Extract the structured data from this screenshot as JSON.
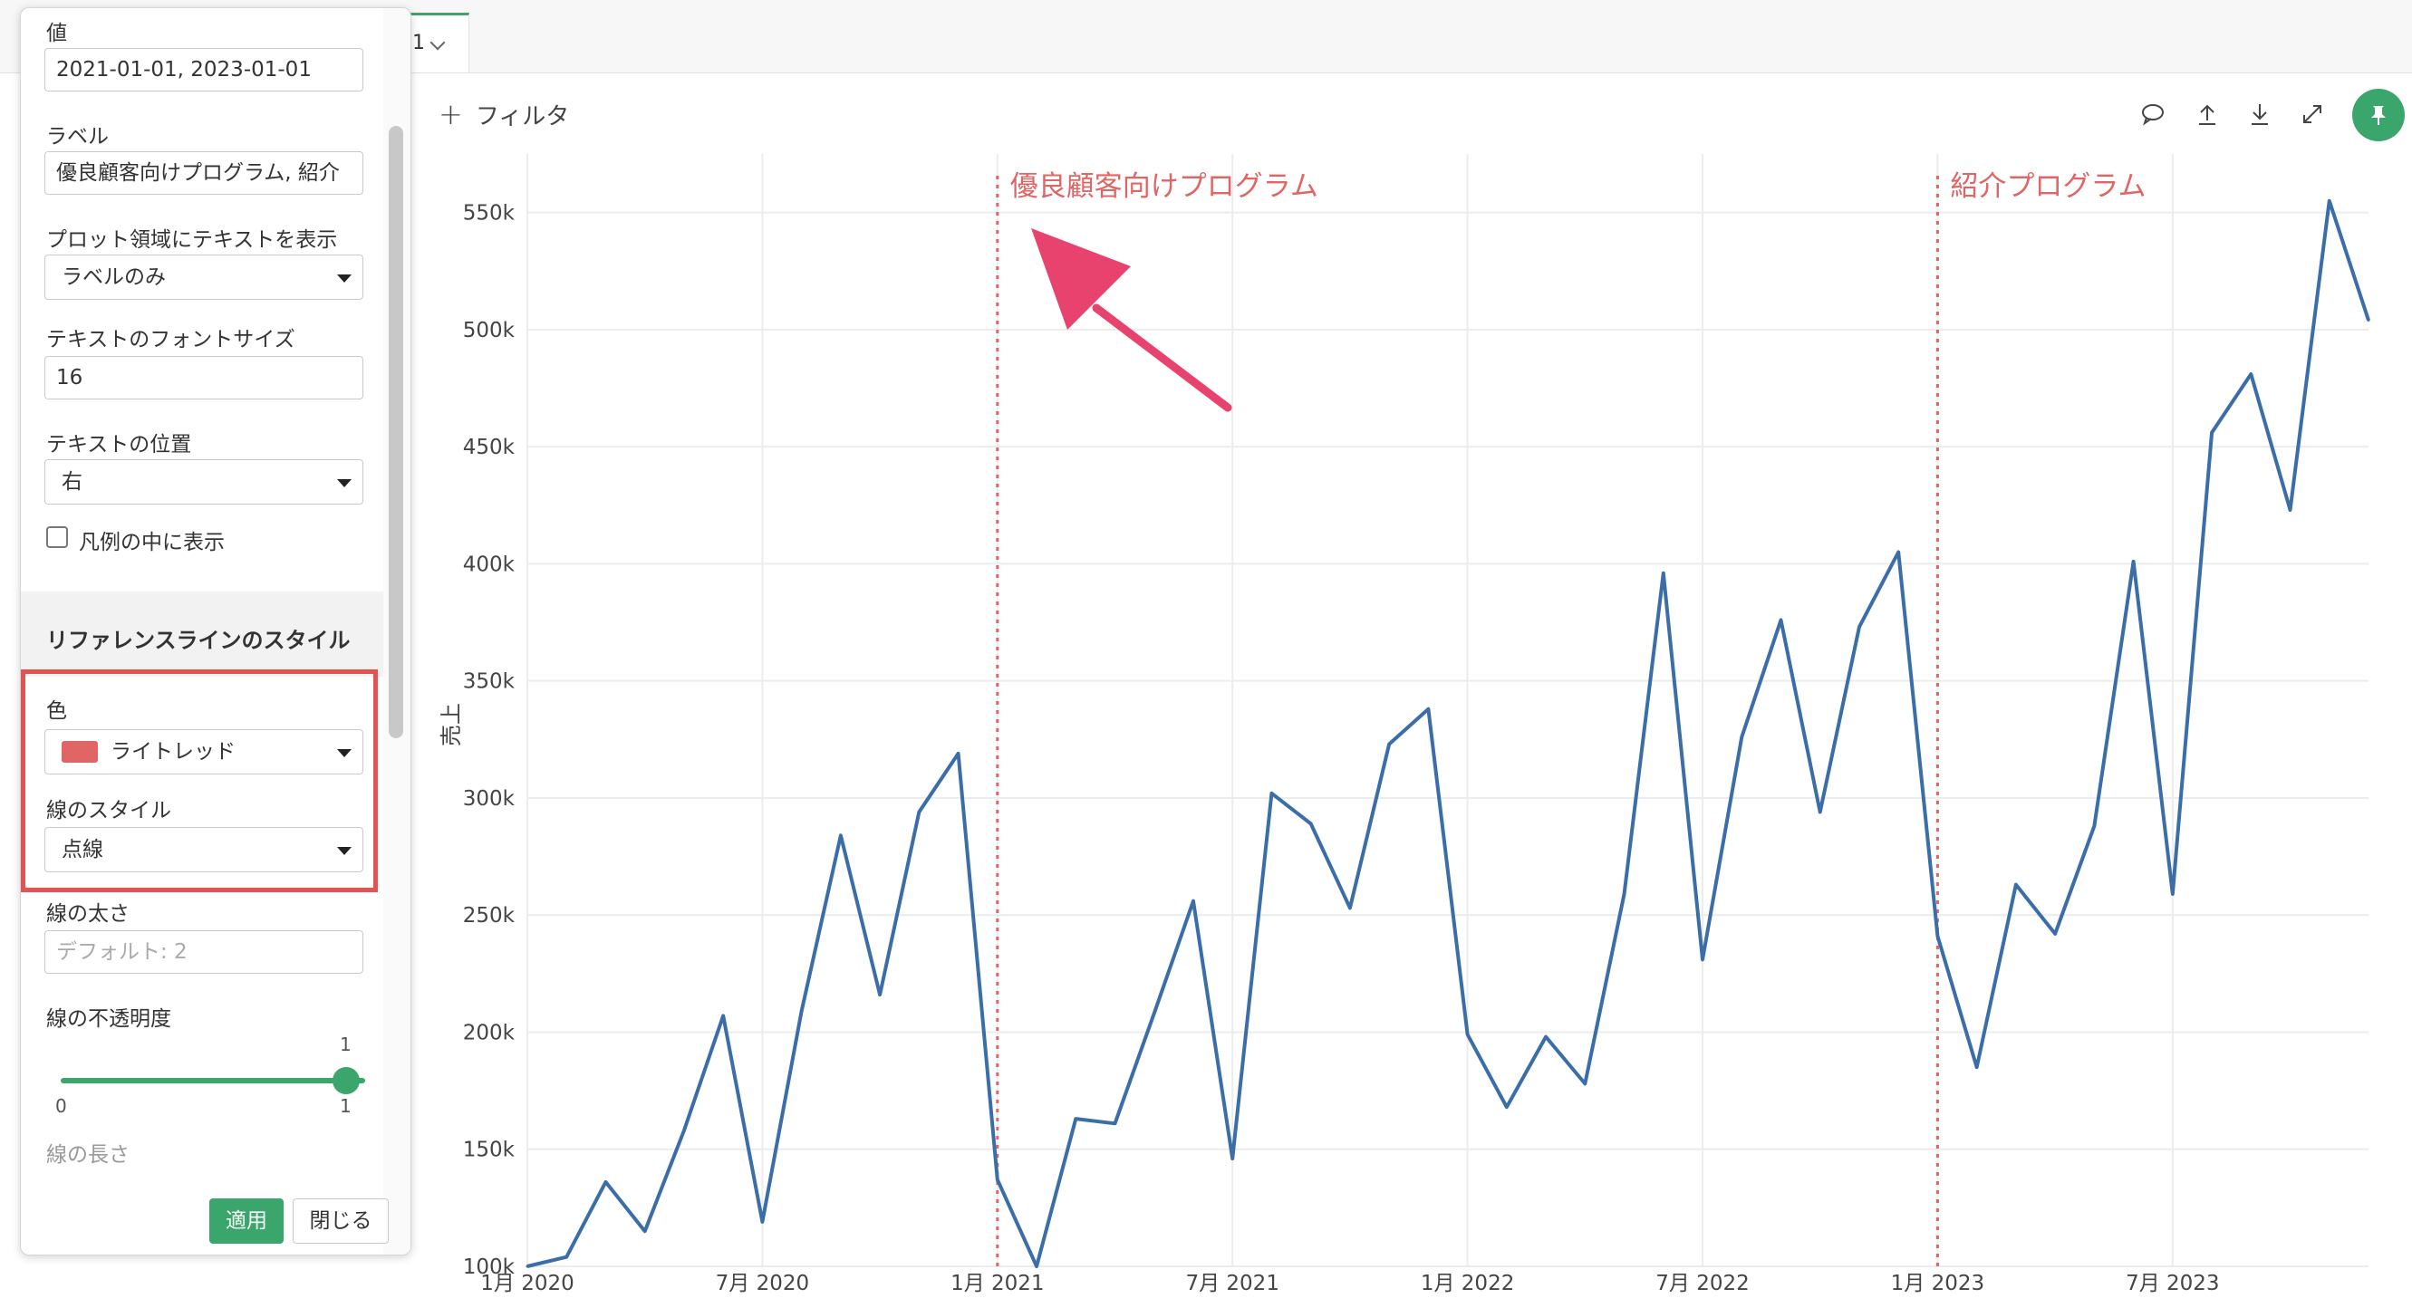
{
  "tab": {
    "label": "1"
  },
  "toolbar": {
    "filter_label": "フィルタ",
    "icons": [
      "comment-icon",
      "upload-icon",
      "download-icon",
      "expand-icon",
      "pin-icon"
    ],
    "accent": "#3aa66b"
  },
  "panel": {
    "value_label": "値",
    "value": "2021-01-01, 2023-01-01",
    "label_label": "ラベル",
    "label_value": "優良顧客向けプログラム, 紹介",
    "show_text_label": "プロット領域にテキストを表示",
    "show_text_value": "ラベルのみ",
    "font_size_label": "テキストのフォントサイズ",
    "font_size_value": "16",
    "text_position_label": "テキストの位置",
    "text_position_value": "右",
    "legend_checkbox_label": "凡例の中に表示",
    "legend_checked": false,
    "section_title": "リファレンスラインのスタイル",
    "color_label": "色",
    "color_value": "ライトレッド",
    "color_hex": "#e06666",
    "line_style_label": "線のスタイル",
    "line_style_value": "点線",
    "line_width_label": "線の太さ",
    "line_width_placeholder": "デフォルト: 2",
    "opacity_label": "線の不透明度",
    "opacity_value": 1,
    "opacity_min": "0",
    "opacity_max": "1",
    "opacity_current": "1",
    "line_length_label": "線の長さ",
    "apply_label": "適用",
    "close_label": "閉じる"
  },
  "chart_data": {
    "type": "line",
    "ylabel": "売上",
    "xlabel": "",
    "ylim": [
      100000,
      575000
    ],
    "yticks": [
      100000,
      150000,
      200000,
      250000,
      300000,
      350000,
      400000,
      450000,
      500000,
      550000
    ],
    "ytick_labels": [
      "100k",
      "150k",
      "200k",
      "250k",
      "300k",
      "350k",
      "400k",
      "450k",
      "500k",
      "550k"
    ],
    "xtick_labels": [
      "1月 2020",
      "7月 2020",
      "1月 2021",
      "7月 2021",
      "1月 2022",
      "7月 2022",
      "1月 2023",
      "7月 2023"
    ],
    "xtick_positions": [
      0,
      6,
      12,
      18,
      24,
      30,
      36,
      42
    ],
    "xlim": [
      0,
      47
    ],
    "grid": true,
    "line_color": "#3b6ea8",
    "series": [
      {
        "values": [
          100000,
          104000,
          136000,
          115000,
          158000,
          207000,
          119000,
          209000,
          284000,
          216000,
          294000,
          319000,
          137000,
          100000,
          163000,
          161000,
          208000,
          256000,
          146000,
          302000,
          289000,
          253000,
          323000,
          338000,
          199000,
          168000,
          198000,
          178000,
          259000,
          396000,
          231000,
          326000,
          376000,
          294000,
          373000,
          405000,
          241000,
          185000,
          263000,
          242000,
          288000,
          401000,
          259000,
          456000,
          481000,
          423000,
          555000,
          504000
        ]
      }
    ],
    "reference_lines": [
      {
        "x": 12,
        "label": "優良顧客向けプログラム",
        "color": "#e06666",
        "style": "dotted"
      },
      {
        "x": 36,
        "label": "紹介プログラム",
        "color": "#e06666",
        "style": "dotted"
      }
    ]
  }
}
